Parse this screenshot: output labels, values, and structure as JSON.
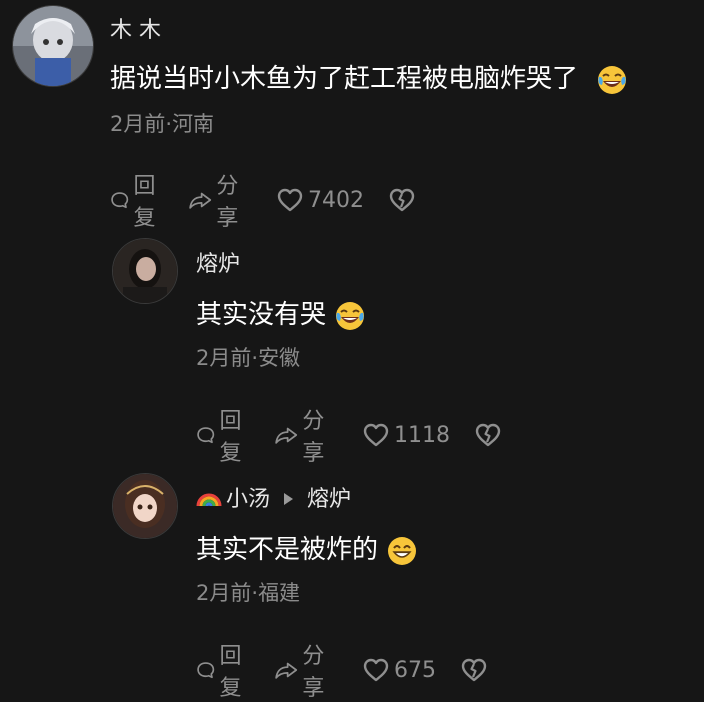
{
  "comments": [
    {
      "username": "木 木",
      "text": "据说当时小木鱼为了赶工程被电脑炸哭了",
      "emoji": "laughing-crying-emoji",
      "time": "2月前",
      "location": "河南",
      "reply_label": "回复",
      "share_label": "分享",
      "likes": "7402"
    },
    {
      "username": "熔炉",
      "text": "其实没有哭",
      "emoji": "laughing-crying-emoji",
      "time": "2月前",
      "location": "安徽",
      "reply_label": "回复",
      "share_label": "分享",
      "likes": "1118"
    },
    {
      "username": "小汤",
      "reply_to": "熔炉",
      "username_icon": "rainbow-icon",
      "text": "其实不是被炸的",
      "emoji": "grinning-emoji",
      "time": "2月前",
      "location": "福建",
      "reply_label": "回复",
      "share_label": "分享",
      "likes": "675"
    }
  ],
  "colors": {
    "background": "#161616",
    "text_primary": "#ffffff",
    "text_secondary": "#8b8b8b"
  }
}
